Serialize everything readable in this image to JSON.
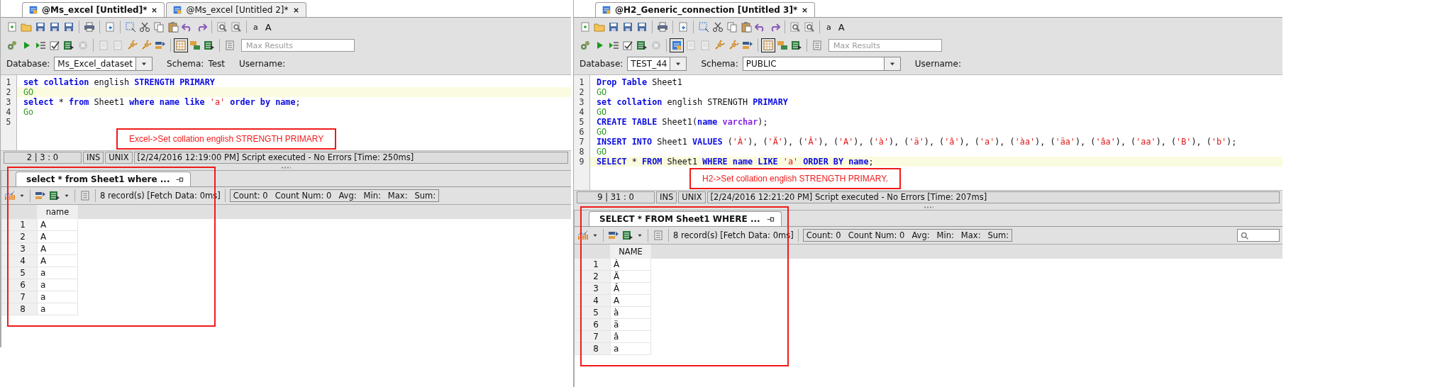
{
  "panes": [
    {
      "tabs": [
        {
          "label": "@Ms_excel [Untitled]*",
          "selected": true
        },
        {
          "label": "@Ms_excel [Untitled 2]*",
          "selected": false
        }
      ],
      "toolbar": {
        "font_buttons": [
          "a",
          "A"
        ],
        "max_results_placeholder": "Max Results"
      },
      "connection": {
        "database_label": "Database:",
        "database": "Ms_Excel_dataset",
        "schema_label": "Schema:",
        "schema": {
          "kind": "text",
          "value": "Test"
        },
        "username_label": "Username:"
      },
      "editor": {
        "lines": [
          {
            "number": "1",
            "current": false,
            "tokens": [
              {
                "kind": "kw",
                "text": "set collation"
              },
              {
                "kind": "plain",
                "text": " english "
              },
              {
                "kind": "kw",
                "text": "STRENGTH PRIMARY"
              }
            ]
          },
          {
            "number": "2",
            "current": true,
            "tokens": [
              {
                "kind": "go",
                "text": "GO"
              }
            ]
          },
          {
            "number": "3",
            "current": false,
            "tokens": [
              {
                "kind": "kw",
                "text": "select"
              },
              {
                "kind": "plain",
                "text": " * "
              },
              {
                "kind": "kw",
                "text": "from"
              },
              {
                "kind": "plain",
                "text": " Sheet1 "
              },
              {
                "kind": "kw",
                "text": "where name like "
              },
              {
                "kind": "str",
                "text": "'a'"
              },
              {
                "kind": "kw",
                "text": " order by name"
              },
              {
                "kind": "plain",
                "text": ";"
              }
            ]
          },
          {
            "number": "4",
            "current": false,
            "tokens": [
              {
                "kind": "go",
                "text": "Go"
              }
            ]
          },
          {
            "number": "5",
            "current": false
          }
        ]
      },
      "annotation": "Excel->Set collation english STRENGTH PRIMARY",
      "status_bar": {
        "position": "2 | 3 : 0",
        "mode": "INS",
        "line_ending": "UNIX",
        "message": "[2/24/2016 12:19:00 PM] Script executed - No Errors [Time: 250ms]"
      },
      "results": {
        "tab": {
          "label": "select * from Sheet1 where ...",
          "selected": true
        },
        "record_info": "8 record(s) [Fetch Data: 0ms]",
        "stats": [
          "Count: 0",
          "Count Num: 0",
          "Avg:",
          "Min:",
          "Max:",
          "Sum:"
        ],
        "columns": [
          "name"
        ],
        "rows": [
          {
            "number": "1",
            "cells": [
              "A"
            ]
          },
          {
            "number": "2",
            "cells": [
              "A"
            ]
          },
          {
            "number": "3",
            "cells": [
              "A"
            ]
          },
          {
            "number": "4",
            "cells": [
              "A"
            ]
          },
          {
            "number": "5",
            "cells": [
              "a"
            ]
          },
          {
            "number": "6",
            "cells": [
              "a"
            ]
          },
          {
            "number": "7",
            "cells": [
              "a"
            ]
          },
          {
            "number": "8",
            "cells": [
              "a"
            ]
          }
        ]
      }
    },
    {
      "tabs": [
        {
          "label": "@H2_Generic_connection [Untitled 3]*",
          "selected": true
        }
      ],
      "toolbar": {
        "font_buttons": [
          "a",
          "A"
        ],
        "max_results_placeholder": "Max Results",
        "commit_toggle": true
      },
      "connection": {
        "database_label": "Database:",
        "database": "TEST_44",
        "schema_label": "Schema:",
        "schema": {
          "kind": "dropdown",
          "value": "PUBLIC"
        },
        "username_label": "Username:"
      },
      "editor": {
        "lines": [
          {
            "number": "1",
            "current": false,
            "tokens": [
              {
                "kind": "kw",
                "text": "Drop Table"
              },
              {
                "kind": "plain",
                "text": " Sheet1"
              }
            ]
          },
          {
            "number": "2",
            "current": false,
            "tokens": [
              {
                "kind": "go",
                "text": "GO"
              }
            ]
          },
          {
            "number": "3",
            "current": false,
            "tokens": [
              {
                "kind": "kw",
                "text": "set collation"
              },
              {
                "kind": "plain",
                "text": " english STRENGTH "
              },
              {
                "kind": "kw",
                "text": "PRIMARY"
              }
            ]
          },
          {
            "number": "4",
            "current": false,
            "tokens": [
              {
                "kind": "go",
                "text": "GO"
              }
            ]
          },
          {
            "number": "5",
            "current": false,
            "tokens": [
              {
                "kind": "kw",
                "text": "CREATE TABLE"
              },
              {
                "kind": "plain",
                "text": " Sheet1("
              },
              {
                "kind": "kw",
                "text": "name "
              },
              {
                "kind": "type",
                "text": "varchar"
              },
              {
                "kind": "plain",
                "text": ");"
              }
            ]
          },
          {
            "number": "6",
            "current": false,
            "tokens": [
              {
                "kind": "go",
                "text": "GO"
              }
            ]
          },
          {
            "number": "7",
            "current": false,
            "tokens": [
              {
                "kind": "kw",
                "text": "INSERT INTO"
              },
              {
                "kind": "plain",
                "text": " Sheet1 "
              },
              {
                "kind": "kw",
                "text": "VALUES"
              },
              {
                "kind": "plain",
                "text": " ("
              },
              {
                "kind": "str",
                "text": "'À'"
              },
              {
                "kind": "plain",
                "text": "), ("
              },
              {
                "kind": "str",
                "text": "'Ä'"
              },
              {
                "kind": "plain",
                "text": "), ("
              },
              {
                "kind": "str",
                "text": "'Â'"
              },
              {
                "kind": "plain",
                "text": "), ("
              },
              {
                "kind": "str",
                "text": "'A'"
              },
              {
                "kind": "plain",
                "text": "), ("
              },
              {
                "kind": "str",
                "text": "'à'"
              },
              {
                "kind": "plain",
                "text": "), ("
              },
              {
                "kind": "str",
                "text": "'ä'"
              },
              {
                "kind": "plain",
                "text": "), ("
              },
              {
                "kind": "str",
                "text": "'â'"
              },
              {
                "kind": "plain",
                "text": "), ("
              },
              {
                "kind": "str",
                "text": "'a'"
              },
              {
                "kind": "plain",
                "text": "), ("
              },
              {
                "kind": "str",
                "text": "'àa'"
              },
              {
                "kind": "plain",
                "text": "), ("
              },
              {
                "kind": "str",
                "text": "'äa'"
              },
              {
                "kind": "plain",
                "text": "), ("
              },
              {
                "kind": "str",
                "text": "'âa'"
              },
              {
                "kind": "plain",
                "text": "), ("
              },
              {
                "kind": "str",
                "text": "'aa'"
              },
              {
                "kind": "plain",
                "text": "), ("
              },
              {
                "kind": "str",
                "text": "'B'"
              },
              {
                "kind": "plain",
                "text": "), ("
              },
              {
                "kind": "str",
                "text": "'b'"
              },
              {
                "kind": "plain",
                "text": ");"
              }
            ]
          },
          {
            "number": "8",
            "current": false,
            "tokens": [
              {
                "kind": "go",
                "text": "GO"
              }
            ]
          },
          {
            "number": "9",
            "current": true,
            "tokens": [
              {
                "kind": "kw",
                "text": "SELECT"
              },
              {
                "kind": "plain",
                "text": " * "
              },
              {
                "kind": "kw",
                "text": "FROM"
              },
              {
                "kind": "plain",
                "text": " Sheet1 "
              },
              {
                "kind": "kw",
                "text": "WHERE name LIKE "
              },
              {
                "kind": "str",
                "text": "'a'"
              },
              {
                "kind": "kw",
                "text": " ORDER BY name"
              },
              {
                "kind": "plain",
                "text": ";"
              }
            ]
          }
        ]
      },
      "annotation": "H2->Set collation english STRENGTH PRIMARY.",
      "status_bar": {
        "position": "9 | 31 : 0",
        "mode": "INS",
        "line_ending": "UNIX",
        "message": "[2/24/2016 12:21:20 PM] Script executed - No Errors [Time: 207ms]"
      },
      "results": {
        "tab": {
          "label": "SELECT * FROM Sheet1 WHERE ...",
          "selected": true
        },
        "record_info": "8 record(s) [Fetch Data: 0ms]",
        "stats": [
          "Count: 0",
          "Count Num: 0",
          "Avg:",
          "Min:",
          "Max:",
          "Sum:"
        ],
        "search_field": true,
        "columns": [
          "NAME"
        ],
        "rows": [
          {
            "number": "1",
            "cells": [
              "À"
            ]
          },
          {
            "number": "2",
            "cells": [
              "Ä"
            ]
          },
          {
            "number": "3",
            "cells": [
              "Â"
            ]
          },
          {
            "number": "4",
            "cells": [
              "A"
            ]
          },
          {
            "number": "5",
            "cells": [
              "à"
            ]
          },
          {
            "number": "6",
            "cells": [
              "ä"
            ]
          },
          {
            "number": "7",
            "cells": [
              "â"
            ]
          },
          {
            "number": "8",
            "cells": [
              "a"
            ]
          }
        ]
      }
    }
  ]
}
